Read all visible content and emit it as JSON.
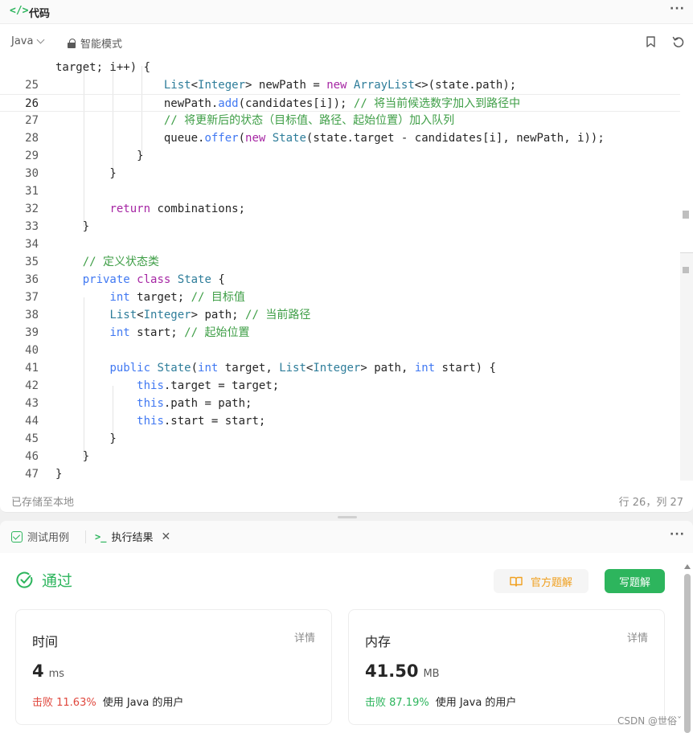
{
  "code_panel": {
    "icon": "</>",
    "title": "代码",
    "more": "···"
  },
  "toolbar": {
    "language": "Java",
    "mode": "智能模式",
    "icons": [
      "bookmark-icon",
      "reset-icon"
    ]
  },
  "editor": {
    "current_line": "26",
    "lines": [
      {
        "n": "",
        "t": [
          [
            "target; i++) {",
            "pl"
          ]
        ]
      },
      {
        "n": "25",
        "t": [
          [
            "                List",
            "ty"
          ],
          [
            "<",
            "pl"
          ],
          [
            "Integer",
            "ty"
          ],
          [
            "> newPath = ",
            "pl"
          ],
          [
            "new",
            "kw"
          ],
          [
            " ",
            "pl"
          ],
          [
            "ArrayList",
            "ty"
          ],
          [
            "<>(state.path);",
            "pl"
          ]
        ]
      },
      {
        "n": "26",
        "t": [
          [
            "                newPath.",
            "pl"
          ],
          [
            "add",
            "fn"
          ],
          [
            "(candidates[i]); ",
            "pl"
          ],
          [
            "// 将当前候选数字加入到路径中",
            "cm"
          ]
        ]
      },
      {
        "n": "27",
        "t": [
          [
            "                ",
            "pl"
          ],
          [
            "// 将更新后的状态（目标值、路径、起始位置）加入队列",
            "cm"
          ]
        ]
      },
      {
        "n": "28",
        "t": [
          [
            "                queue.",
            "pl"
          ],
          [
            "offer",
            "fn"
          ],
          [
            "(",
            "pl"
          ],
          [
            "new",
            "kw"
          ],
          [
            " ",
            "pl"
          ],
          [
            "State",
            "ty"
          ],
          [
            "(state.target - candidates[i], newPath, i));",
            "pl"
          ]
        ]
      },
      {
        "n": "29",
        "t": [
          [
            "            }",
            "pl"
          ]
        ]
      },
      {
        "n": "30",
        "t": [
          [
            "        }",
            "pl"
          ]
        ]
      },
      {
        "n": "31",
        "t": [
          [
            "",
            "pl"
          ]
        ]
      },
      {
        "n": "32",
        "t": [
          [
            "        ",
            "pl"
          ],
          [
            "return",
            "kw"
          ],
          [
            " combinations;",
            "pl"
          ]
        ]
      },
      {
        "n": "33",
        "t": [
          [
            "    }",
            "pl"
          ]
        ]
      },
      {
        "n": "34",
        "t": [
          [
            "",
            "pl"
          ]
        ]
      },
      {
        "n": "35",
        "t": [
          [
            "    ",
            "pl"
          ],
          [
            "// 定义状态类",
            "cm"
          ]
        ]
      },
      {
        "n": "36",
        "t": [
          [
            "    ",
            "pl"
          ],
          [
            "private",
            "kwb"
          ],
          [
            " ",
            "pl"
          ],
          [
            "class",
            "kw"
          ],
          [
            " ",
            "pl"
          ],
          [
            "State",
            "ty"
          ],
          [
            " {",
            "pl"
          ]
        ]
      },
      {
        "n": "37",
        "t": [
          [
            "        ",
            "pl"
          ],
          [
            "int",
            "kwb"
          ],
          [
            " target; ",
            "pl"
          ],
          [
            "// 目标值",
            "cm"
          ]
        ]
      },
      {
        "n": "38",
        "t": [
          [
            "        ",
            "pl"
          ],
          [
            "List",
            "ty"
          ],
          [
            "<",
            "pl"
          ],
          [
            "Integer",
            "ty"
          ],
          [
            "> path; ",
            "pl"
          ],
          [
            "// 当前路径",
            "cm"
          ]
        ]
      },
      {
        "n": "39",
        "t": [
          [
            "        ",
            "pl"
          ],
          [
            "int",
            "kwb"
          ],
          [
            " start; ",
            "pl"
          ],
          [
            "// 起始位置",
            "cm"
          ]
        ]
      },
      {
        "n": "40",
        "t": [
          [
            "",
            "pl"
          ]
        ]
      },
      {
        "n": "41",
        "t": [
          [
            "        ",
            "pl"
          ],
          [
            "public",
            "kwb"
          ],
          [
            " ",
            "pl"
          ],
          [
            "State",
            "ty"
          ],
          [
            "(",
            "pl"
          ],
          [
            "int",
            "kwb"
          ],
          [
            " target, ",
            "pl"
          ],
          [
            "List",
            "ty"
          ],
          [
            "<",
            "pl"
          ],
          [
            "Integer",
            "ty"
          ],
          [
            "> path, ",
            "pl"
          ],
          [
            "int",
            "kwb"
          ],
          [
            " start) {",
            "pl"
          ]
        ]
      },
      {
        "n": "42",
        "t": [
          [
            "            ",
            "pl"
          ],
          [
            "this",
            "kwb"
          ],
          [
            ".target = target;",
            "pl"
          ]
        ]
      },
      {
        "n": "43",
        "t": [
          [
            "            ",
            "pl"
          ],
          [
            "this",
            "kwb"
          ],
          [
            ".path = path;",
            "pl"
          ]
        ]
      },
      {
        "n": "44",
        "t": [
          [
            "            ",
            "pl"
          ],
          [
            "this",
            "kwb"
          ],
          [
            ".start = start;",
            "pl"
          ]
        ]
      },
      {
        "n": "45",
        "t": [
          [
            "        }",
            "pl"
          ]
        ]
      },
      {
        "n": "46",
        "t": [
          [
            "    }",
            "pl"
          ]
        ]
      },
      {
        "n": "47",
        "t": [
          [
            "}",
            "pl"
          ]
        ]
      }
    ]
  },
  "status_bar": {
    "saved": "已存储至本地",
    "cursor": "行 26，列 27"
  },
  "result_panel": {
    "tabs": [
      {
        "label": "测试用例",
        "icon": "checkbox-icon"
      },
      {
        "label": "执行结果",
        "icon": "terminal-icon",
        "prefix": ">_",
        "close": "✕"
      }
    ],
    "more": "···",
    "status": "通过",
    "official_solution": "官方题解",
    "write_solution": "写题解",
    "time": {
      "label": "时间",
      "detail": "详情",
      "value": "4",
      "unit": "ms",
      "beat": "击败 11.63%",
      "desc": "使用 Java 的用户"
    },
    "memory": {
      "label": "内存",
      "detail": "详情",
      "value": "41.50",
      "unit": "MB",
      "beat": "击败 87.19%",
      "desc": "使用 Java 的用户"
    }
  },
  "watermark": "CSDN @世俗ˇ",
  "colors": {
    "accent_green": "#2db55d",
    "beat_red": "#e0483e",
    "official_orange": "#f0a020",
    "keyword_purple": "#a626a4",
    "keyword_blue": "#4078f2",
    "comment_green": "#3e9e46"
  }
}
